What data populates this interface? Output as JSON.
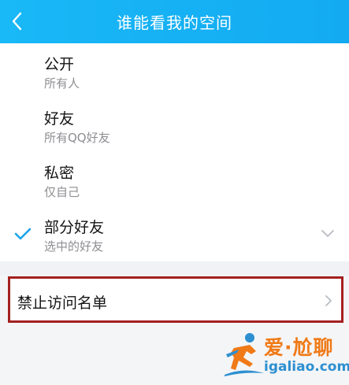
{
  "header": {
    "title": "谁能看我的空间",
    "back_icon": "chevron-left-icon"
  },
  "options": [
    {
      "label": "公开",
      "sub": "所有人",
      "selected": false
    },
    {
      "label": "好友",
      "sub": "所有QQ好友",
      "selected": false
    },
    {
      "label": "私密",
      "sub": "仅自己",
      "selected": false
    },
    {
      "label": "部分好友",
      "sub": "选中的好友",
      "selected": true
    }
  ],
  "blocklist": {
    "label": "禁止访问名单",
    "icon": "chevron-right-icon"
  },
  "watermark": {
    "brand": "爱·尬聊",
    "url": "igaliao.com"
  },
  "colors": {
    "header_start": "#19b8f6",
    "header_end": "#13aaf2",
    "check": "#1aa3e8",
    "highlight_border": "#a32020"
  }
}
